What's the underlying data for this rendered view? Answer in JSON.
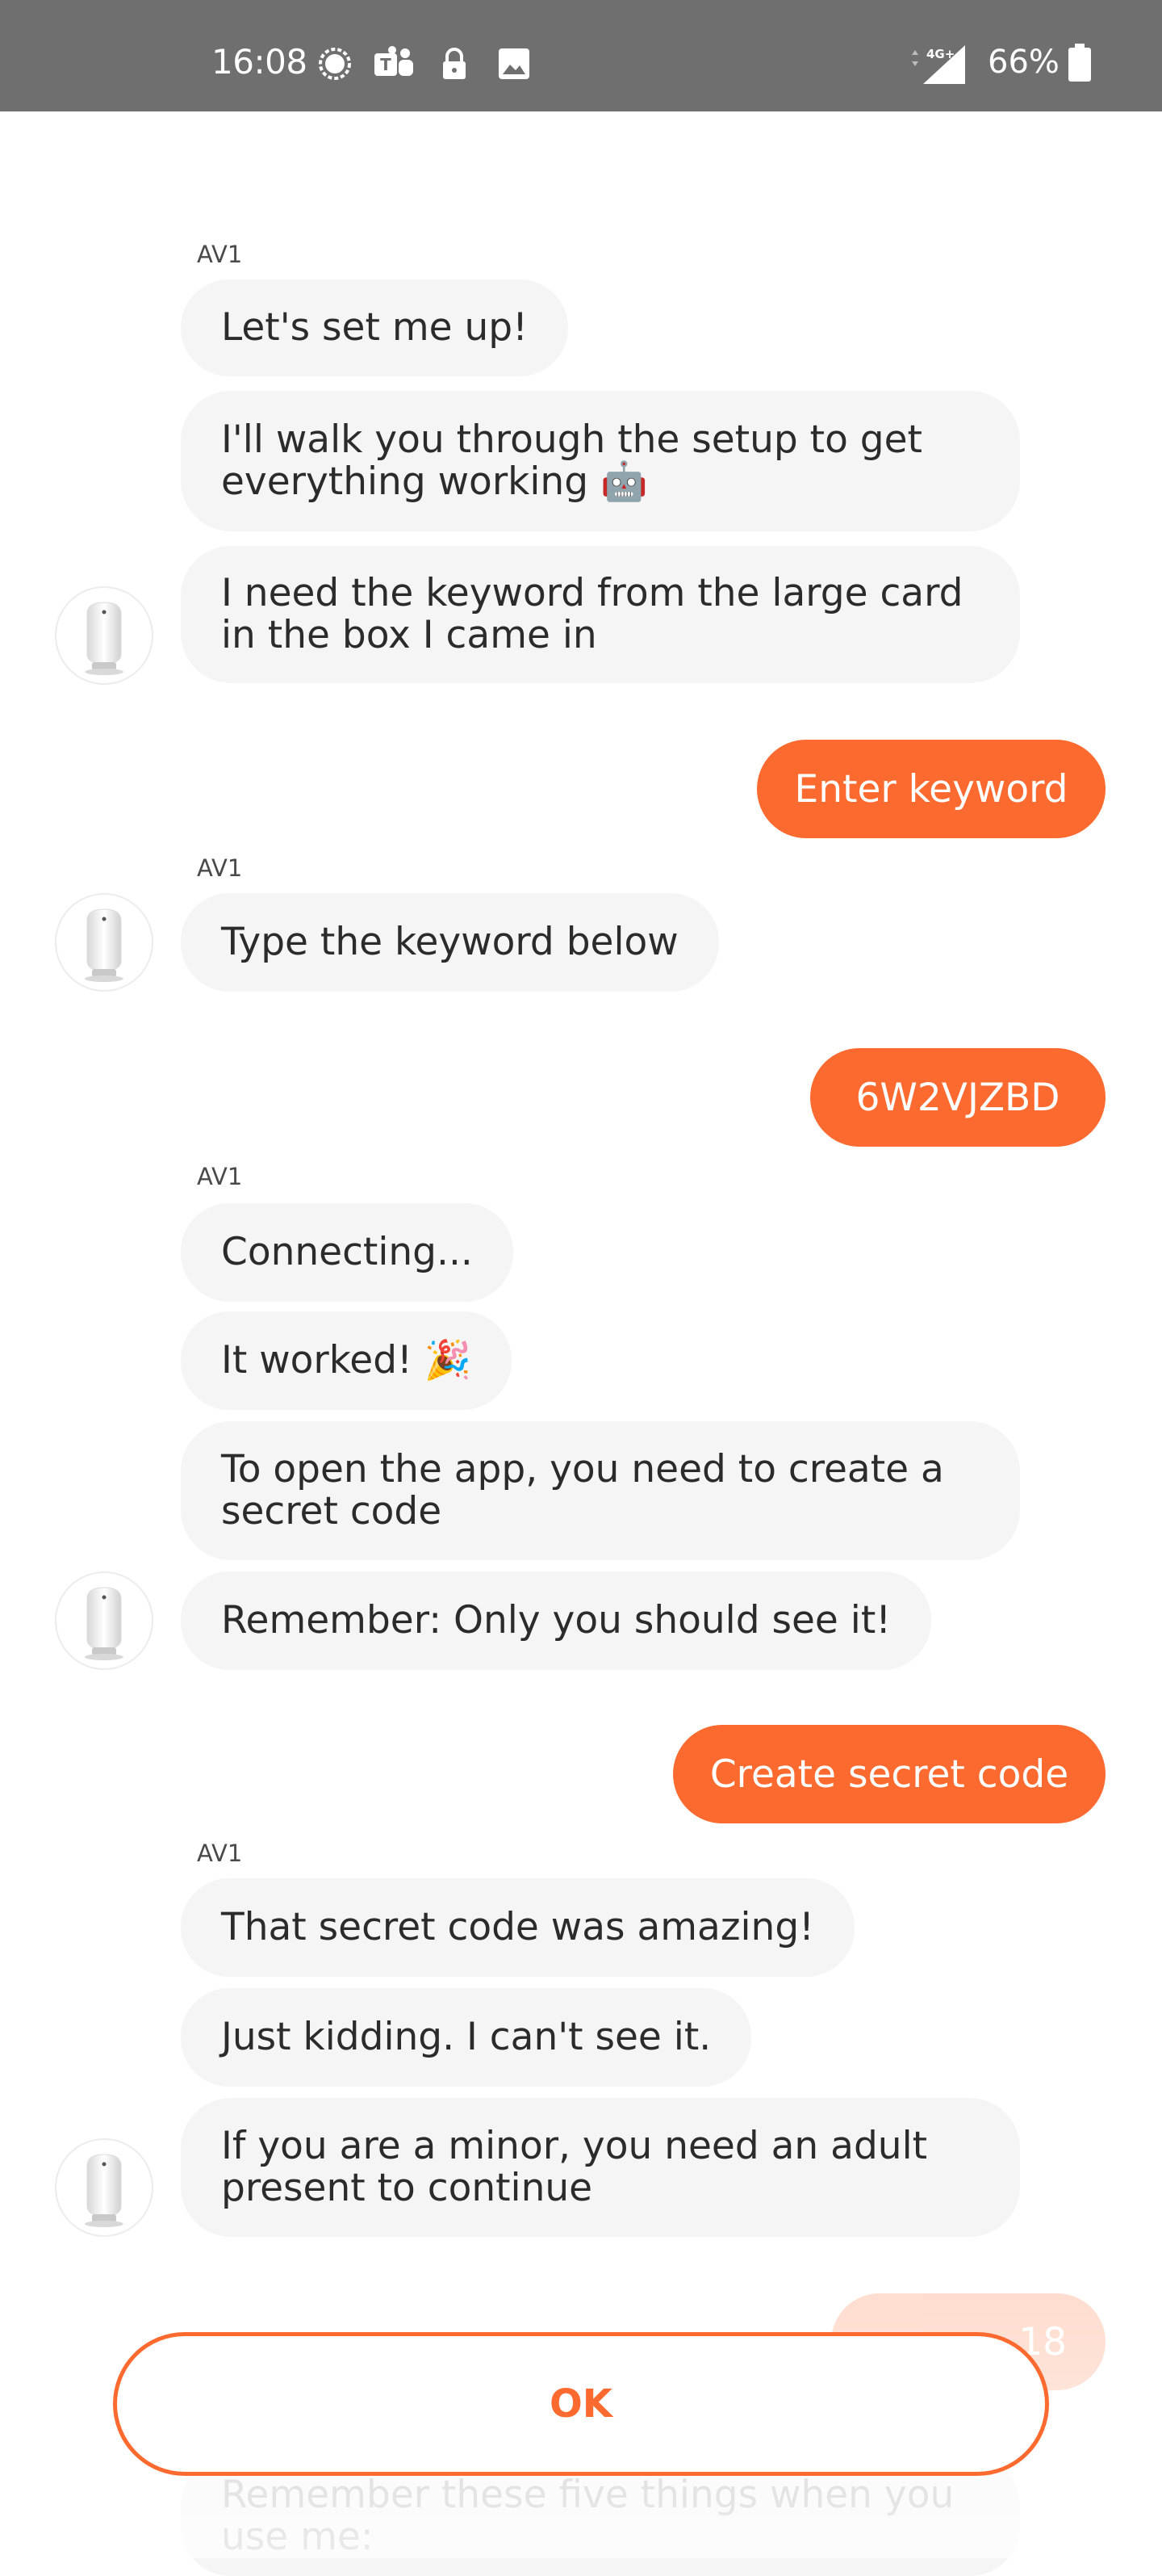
{
  "status_bar": {
    "time": "16:08",
    "notification_icons": [
      "signal-messenger-icon",
      "teams-icon",
      "lock-icon",
      "image-icon"
    ],
    "network": "4G+",
    "battery_percent": "66%"
  },
  "chat": {
    "bot_name": "AV1",
    "group1": {
      "sender": "AV1",
      "messages": [
        "Let's set me up!",
        "I'll walk you through the setup to get\neverything working 🤖",
        "I need the keyword from the large card\nin the box I came in"
      ]
    },
    "user_reply1": "Enter keyword",
    "group2": {
      "sender": "AV1",
      "messages": [
        "Type the keyword below"
      ]
    },
    "user_reply2": "6W2VJZBD",
    "group3": {
      "sender": "AV1",
      "messages": [
        "Connecting...",
        "It worked! 🎉",
        "To open the app, you need to create a\nsecret code",
        "Remember: Only you should see it!"
      ]
    },
    "user_reply3": "Create secret code",
    "group4": {
      "sender": "AV1",
      "messages": [
        "That secret code was amazing!",
        "Just kidding. I can't see it.",
        "If you are a minor, you need an adult\npresent to continue"
      ]
    },
    "faded_user_reply_fragment": "18",
    "faded_message": "Remember these five things when you\nuse me:"
  },
  "action": {
    "ok_label": "OK"
  },
  "colors": {
    "accent": "#fd6a2f",
    "bot_bubble": "#f5f5f5",
    "status_bar": "#6f6f6f"
  }
}
